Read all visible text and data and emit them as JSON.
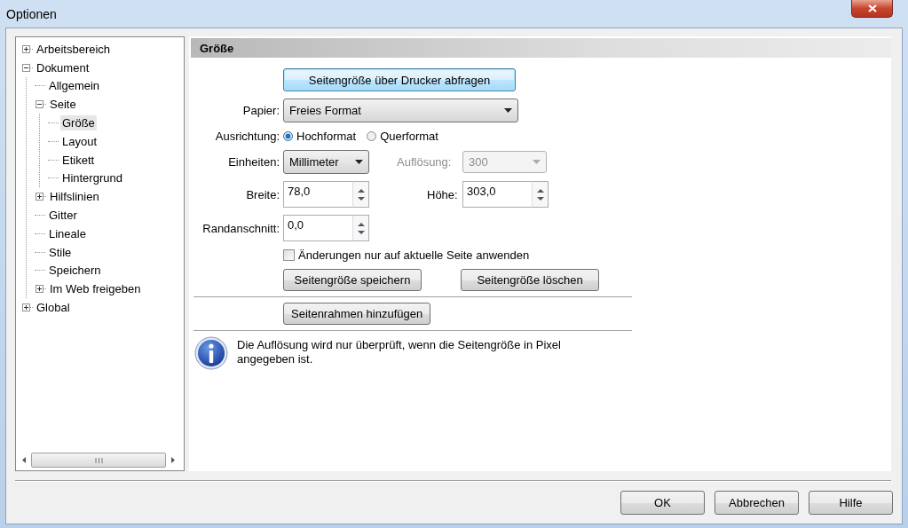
{
  "window": {
    "title": "Optionen"
  },
  "tree": [
    {
      "label": "Arbeitsbereich",
      "kind": "node",
      "expanded": false,
      "selected": false
    },
    {
      "label": "Dokument",
      "kind": "node",
      "expanded": true,
      "selected": false,
      "children": [
        {
          "label": "Allgemein",
          "kind": "leaf",
          "selected": false
        },
        {
          "label": "Seite",
          "kind": "node",
          "expanded": true,
          "selected": false,
          "children": [
            {
              "label": "Größe",
              "kind": "leaf",
              "selected": true
            },
            {
              "label": "Layout",
              "kind": "leaf",
              "selected": false
            },
            {
              "label": "Etikett",
              "kind": "leaf",
              "selected": false
            },
            {
              "label": "Hintergrund",
              "kind": "leaf",
              "selected": false
            }
          ]
        },
        {
          "label": "Hilfslinien",
          "kind": "node",
          "expanded": false,
          "selected": false
        },
        {
          "label": "Gitter",
          "kind": "leaf",
          "selected": false
        },
        {
          "label": "Lineale",
          "kind": "leaf",
          "selected": false
        },
        {
          "label": "Stile",
          "kind": "leaf",
          "selected": false
        },
        {
          "label": "Speichern",
          "kind": "leaf",
          "selected": false
        },
        {
          "label": "Im Web freigeben",
          "kind": "node",
          "expanded": false,
          "selected": false
        }
      ]
    },
    {
      "label": "Global",
      "kind": "node",
      "expanded": false,
      "selected": false
    }
  ],
  "section": {
    "title": "Größe"
  },
  "printer_button": {
    "label": "Seitengröße über Drucker abfragen",
    "focused": true
  },
  "paper": {
    "label": "Papier:",
    "value": "Freies Format"
  },
  "orientation": {
    "label": "Ausrichtung:",
    "options": [
      {
        "label": "Hochformat",
        "selected": true
      },
      {
        "label": "Querformat",
        "selected": false
      }
    ]
  },
  "units": {
    "label": "Einheiten:",
    "value": "Millimeter"
  },
  "resolution": {
    "label": "Auflösung:",
    "value": "300",
    "disabled": true
  },
  "width": {
    "label": "Breite:",
    "value": "78,0"
  },
  "height": {
    "label": "Höhe:",
    "value": "303,0"
  },
  "bleed": {
    "label": "Randanschnitt:",
    "value": "0,0"
  },
  "current_page_only": {
    "label": "Änderungen nur auf aktuelle Seite anwenden",
    "checked": false
  },
  "page_size_buttons": [
    "Seitengröße speichern",
    "Seitengröße löschen"
  ],
  "frame_button": "Seitenrahmen hinzufügen",
  "info": "Die Auflösung wird nur überprüft, wenn die Seitengröße in Pixel angegeben ist.",
  "buttons": [
    "OK",
    "Abbrechen",
    "Hilfe"
  ]
}
